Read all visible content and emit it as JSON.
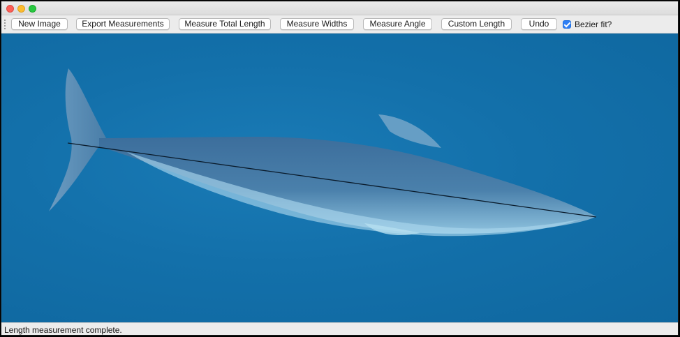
{
  "window": {
    "controls": [
      "close",
      "minimize",
      "zoom"
    ]
  },
  "toolbar": {
    "buttons": [
      {
        "label": "New Image"
      },
      {
        "label": "Export Measurements"
      },
      {
        "label": "Measure Total Length"
      },
      {
        "label": "Measure Widths"
      },
      {
        "label": "Measure Angle"
      },
      {
        "label": "Custom Length"
      },
      {
        "label": "Undo"
      }
    ],
    "bezier": {
      "label": "Bezier fit?",
      "checked": true
    }
  },
  "canvas": {
    "image_subject": "whale",
    "measurement_line": "total-length"
  },
  "status": {
    "message": "Length measurement complete."
  },
  "colors": {
    "water": "#1370aa",
    "checkbox_accent": "#2f7ff5"
  }
}
